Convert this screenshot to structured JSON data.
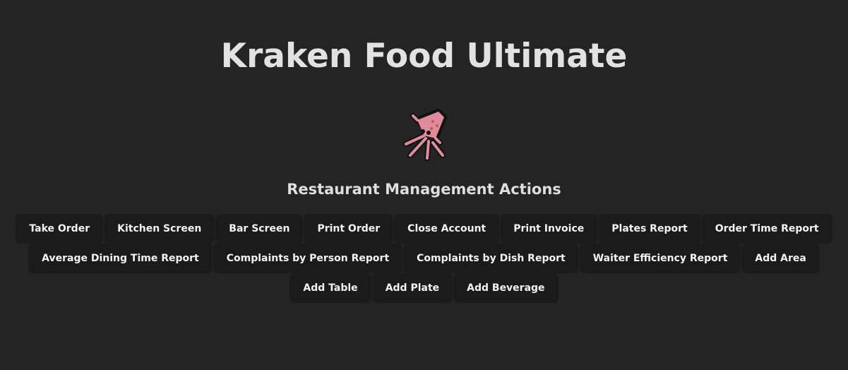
{
  "header": {
    "title": "Kraken Food Ultimate",
    "logo_icon": "squid-icon",
    "logo_color": "#e08a9a"
  },
  "section": {
    "title": "Restaurant Management Actions"
  },
  "actions": [
    "Take Order",
    "Kitchen Screen",
    "Bar Screen",
    "Print Order",
    "Close Account",
    "Print Invoice",
    "Plates Report",
    "Order Time Report",
    "Average Dining Time Report",
    "Complaints by Person Report",
    "Complaints by Dish Report",
    "Waiter Efficiency Report",
    "Add Area",
    "Add Table",
    "Add Plate",
    "Add Beverage"
  ]
}
